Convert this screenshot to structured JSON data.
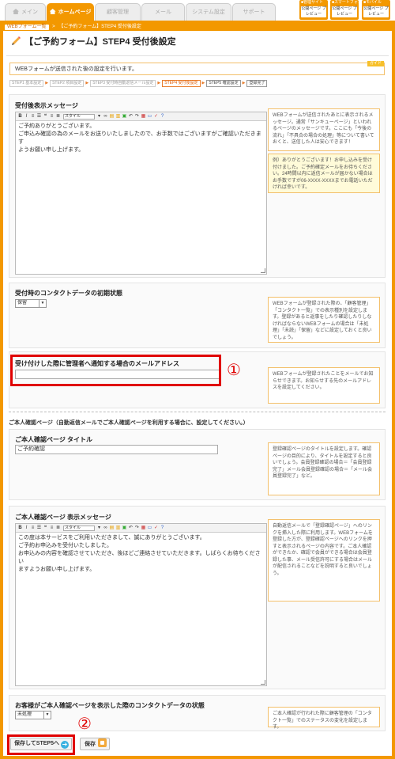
{
  "nav": {
    "tabs": [
      {
        "label": "メイン"
      },
      {
        "label": "ホームページ"
      },
      {
        "label": "顧客管理"
      },
      {
        "label": "メール"
      },
      {
        "label": "システム設定"
      },
      {
        "label": "サポート"
      }
    ],
    "preview_buttons": [
      {
        "title": "■管理サイト",
        "button": "公開ページ プレビュー"
      },
      {
        "title": "■スマートフォン",
        "button": "公開ページ プレビュー"
      },
      {
        "title": "■モバイル",
        "button": "公開ページ プレビュー"
      }
    ]
  },
  "breadcrumb": {
    "button": "WEBフォーム一覧",
    "current": "【ご予約フォーム】STEP4 受付後設定"
  },
  "page": {
    "title": "【ご予約フォーム】STEP4 受付後設定",
    "guide_text": "WEBフォームが送信された後の設定を行います。",
    "guide_tag": "ガイド"
  },
  "steps": [
    "STEP1 基本設定",
    "STEP2 項目設定",
    "STEP3 受付時自動返信メール設定",
    "STEP4 受付後設定",
    "STEP5 確認設定",
    "登録完了"
  ],
  "editor_toolbar": {
    "style_label": "スタイル"
  },
  "sections": {
    "message": {
      "label": "受付後表示メッセージ",
      "lines": [
        "ご予約ありがとうございます。",
        "ご申込み確認の為のメールをお送りいたしましたので、お手数ではございますがご確認いただきます",
        "ようお願い申し上げます。"
      ],
      "help": "WEBフォームが送信されたあとに表示されるメッセージ。通常「サンキューページ」といわれるページのメッセージです。ここにも「今後の流れ」「不具合の場合の処理」等について書いておくと、送信した人は安心できます！",
      "example": "例）ありがとうございます！お申し込みを受け付けました。ご予約確定メールをお待ちください。24時間以内に返信メールが届かない場合はお手数ですが06-XXXX-XXXXまでお電話いただければ幸いです。"
    },
    "initial_status": {
      "label": "受付時のコンタクトデータの初期状態",
      "value": "保留",
      "help": "WEBフォームが登録された際の、「顧客管理」「コンタクト一覧」での表示種別を設定します。登録があると返事をしたり確認したりしなければならないWEBフォームの場合は「未処理」「未読」「保留」などに設定しておくと良いでしょう。"
    },
    "admin_email": {
      "label": "受け付けした際に管理者へ通知する場合のメールアドレス",
      "value": "",
      "marker": "①",
      "help": "WEBフォームが登録されたことをメールでお知らせできます。お知らせする先のメールアドレスを設定してください。"
    },
    "confirm_header": "ご本人確認ページ（自動返信メールでご本人確認ページを利用する場合に、設定してください。）",
    "confirm_title": {
      "label": "ご本人確認ページ タイトル",
      "value": "ご予約確認",
      "help": "登録確認ページのタイトルを設定します。確認ページの目的により、タイトルを設定すると良いでしょう。会員登録確認の場合＝「会員登録完了」メール会員登録確認の場合＝「メール会員登録完了」など。"
    },
    "confirm_message": {
      "label": "ご本人確認ページ 表示メッセージ",
      "lines": [
        "この度は本サービスをご利用いただきまして、誠にありがとうございます。",
        "ご予約お申込みを受付いたしました。",
        "お申込みの内容を確認させていただき、後ほどご連絡させていただきます。しばらくお待ちください",
        "ますようお願い申し上げます。"
      ],
      "help": "自動返信メールで「登録確認ページ」へのリンクを挿入した際に利用します。WEBフォームを登録した方が、登録確認ページへのリンクを押すと表示されるページの内容です。ご本人確認ができたか、確認で会員ができる場合は会員登録した事、メール受信許可にする場合はメールが配信されることなどを説明すると良いでしょう。"
    },
    "confirm_status": {
      "label": "お客様がご本人確認ページを表示した際のコンタクトデータの状態",
      "value": "未処理",
      "help": "ご本人確認が行われた際に顧客管理の「コンタクト一覧」でのステータスの変化を設定します。"
    }
  },
  "footer": {
    "next_button": "保存してSTEP5へ",
    "save_button": "保存",
    "marker": "②"
  },
  "colors": {
    "accent": "#f39800",
    "highlight": "#e00000"
  }
}
